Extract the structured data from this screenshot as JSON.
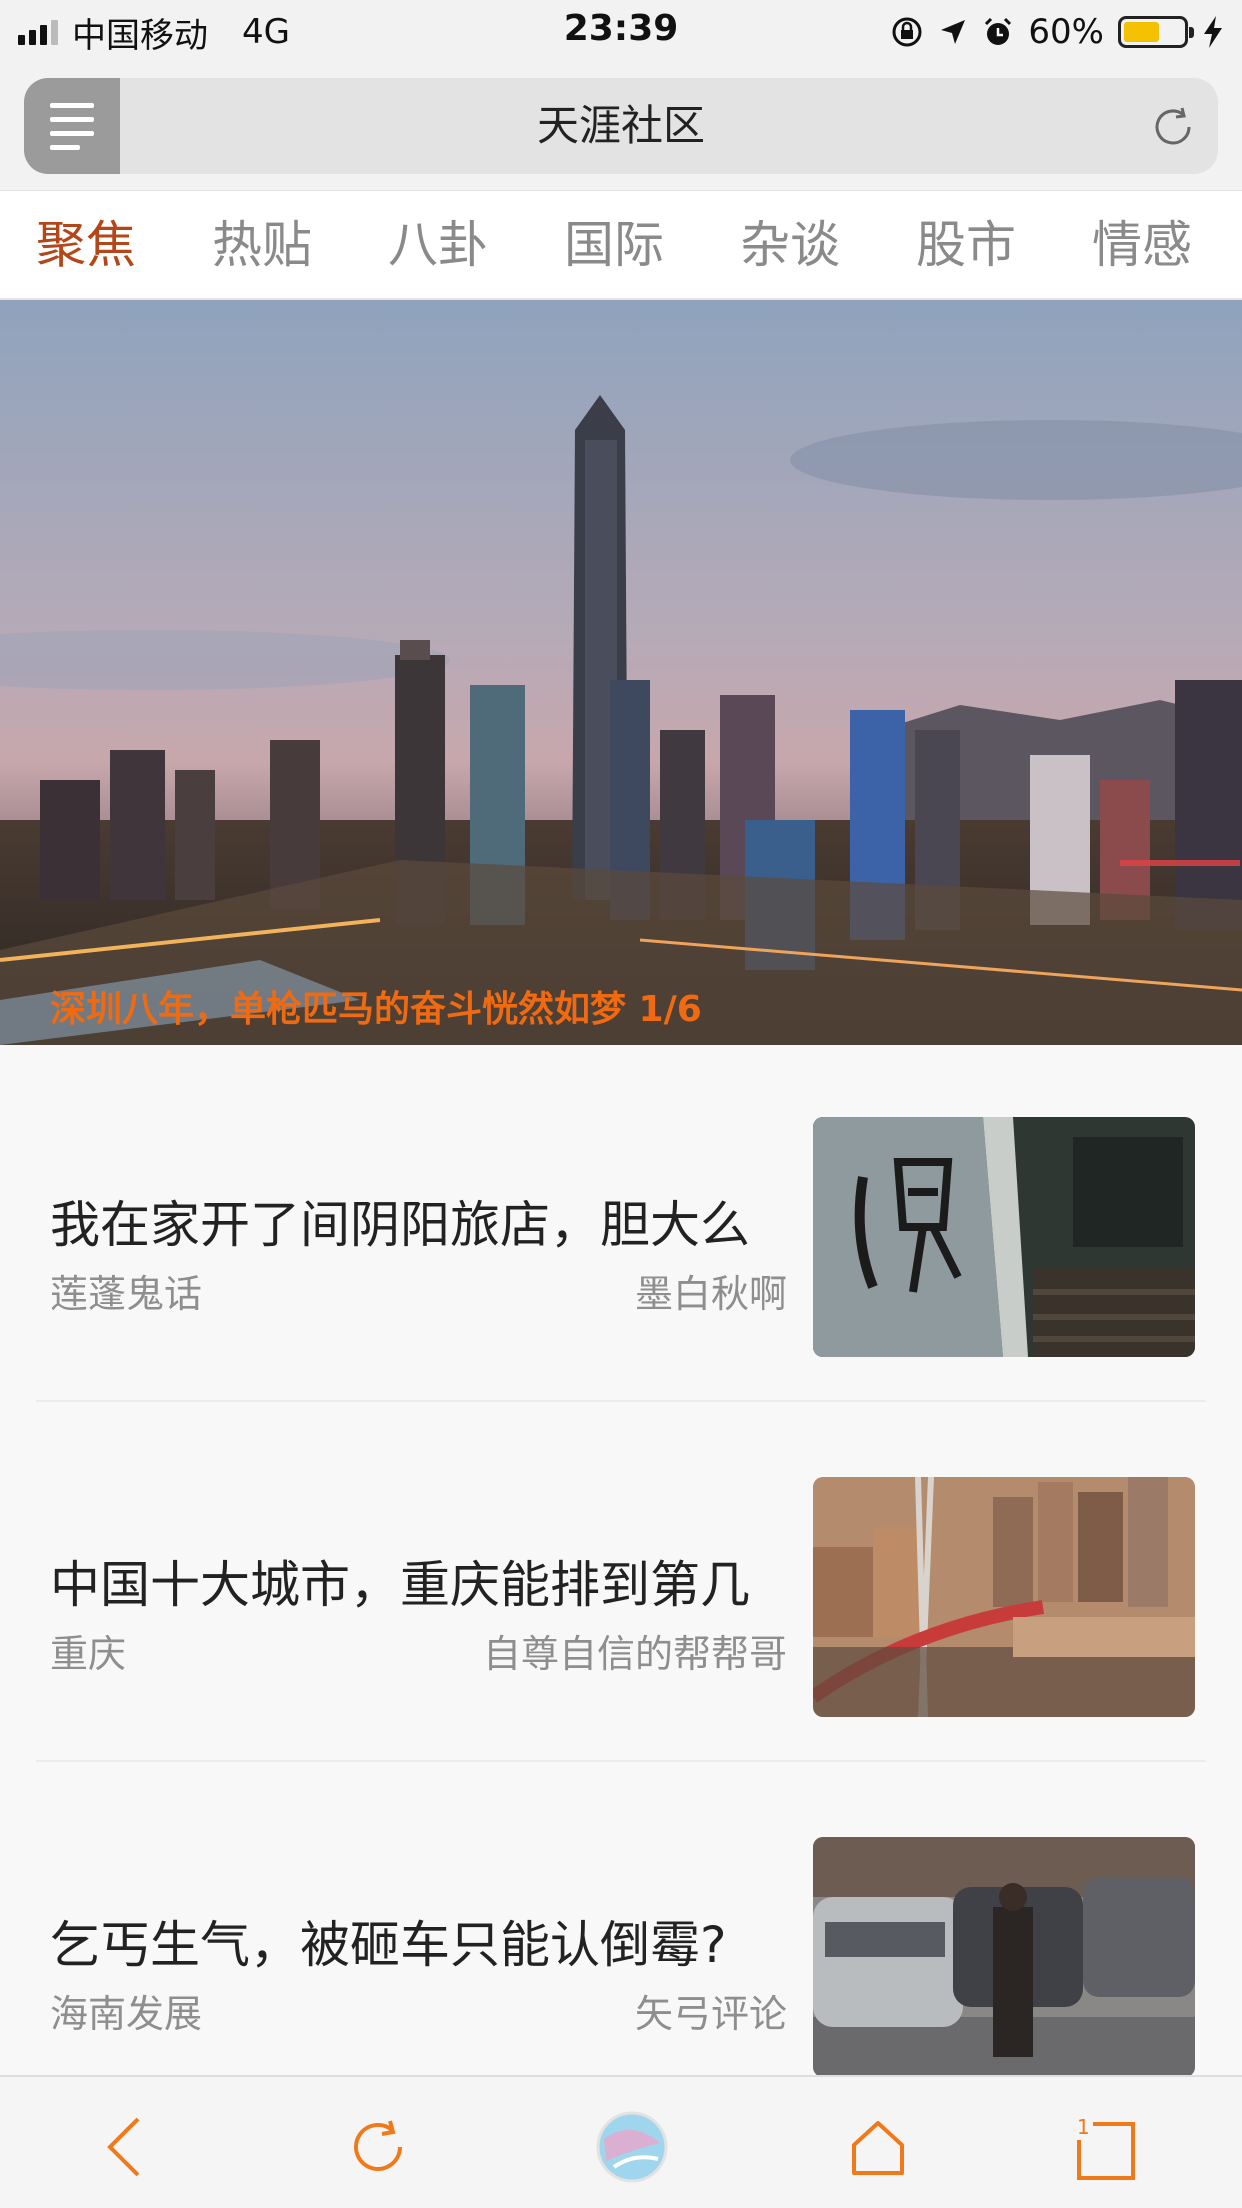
{
  "status_bar": {
    "carrier": "中国移动",
    "network": "4G",
    "time": "23:39",
    "battery": "60%"
  },
  "title_bar": {
    "title": "天涯社区"
  },
  "tabs": [
    {
      "label": "聚焦",
      "active": true
    },
    {
      "label": "热贴",
      "active": false
    },
    {
      "label": "八卦",
      "active": false
    },
    {
      "label": "国际",
      "active": false
    },
    {
      "label": "杂谈",
      "active": false
    },
    {
      "label": "股市",
      "active": false
    },
    {
      "label": "情感",
      "active": false
    }
  ],
  "banner": {
    "caption": "深圳八年，单枪匹马的奋斗恍然如梦 1/6"
  },
  "feed": [
    {
      "title": "我在家开了间阴阳旅店，胆大么",
      "source": "莲蓬鬼话",
      "author": "墨白秋啊",
      "thumb": "ghost-stairs"
    },
    {
      "title": "中国十大城市，重庆能排到第几",
      "source": "重庆",
      "author": "自尊自信的帮帮哥",
      "thumb": "chongqing-bridge"
    },
    {
      "title": "乞丐生气，被砸车只能认倒霉?",
      "source": "海南发展",
      "author": "矢弓评论",
      "thumb": "street-cars"
    }
  ],
  "toolbar": {
    "tabs_count": "1"
  },
  "colors": {
    "accent": "#f07a1a",
    "active_tab": "#b4471a",
    "caption": "#f06a12"
  }
}
